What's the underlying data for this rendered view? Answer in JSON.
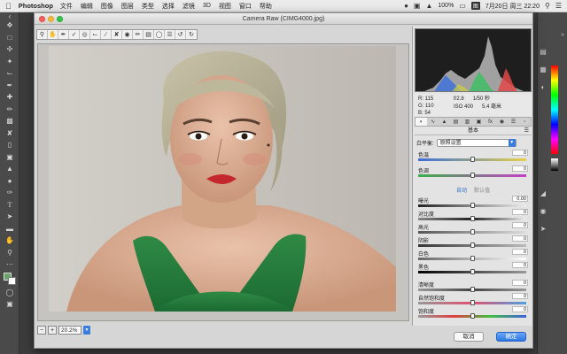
{
  "menubar": {
    "app": "Photoshop",
    "items": [
      "文件",
      "编辑",
      "图像",
      "图层",
      "类型",
      "选择",
      "滤镜",
      "3D",
      "视图",
      "窗口",
      "帮助"
    ],
    "battery": "100%",
    "datetime": "7月20日 周三  22:20",
    "badge": "图"
  },
  "dialog": {
    "title": "Camera Raw (CIMG4000.jpg)",
    "preview_label": "预览",
    "zoom": "20.2%",
    "cancel_label": "取消",
    "ok_label": "确定"
  },
  "readout": {
    "r": "R:  115",
    "g": "G:  110",
    "b": "B:    54",
    "aperture": "f/2.8",
    "shutter": "1/50 秒",
    "iso": "ISO 400",
    "focal": "5.4 毫米"
  },
  "panel": {
    "title": "基本",
    "wb_label": "白平衡:",
    "wb_value": "原照设置",
    "auto_label": "自动",
    "default_label": "默认值",
    "sliders": [
      {
        "label": "色温",
        "value": "0",
        "pos": 0.5
      },
      {
        "label": "色调",
        "value": "0",
        "pos": 0.5
      },
      {
        "label": "曝光",
        "value": "0.00",
        "pos": 0.5
      },
      {
        "label": "对比度",
        "value": "0",
        "pos": 0.5
      },
      {
        "label": "高光",
        "value": "0",
        "pos": 0.5
      },
      {
        "label": "阴影",
        "value": "0",
        "pos": 0.5
      },
      {
        "label": "白色",
        "value": "0",
        "pos": 0.5
      },
      {
        "label": "黑色",
        "value": "0",
        "pos": 0.5
      },
      {
        "label": "清晰度",
        "value": "0",
        "pos": 0.5
      },
      {
        "label": "自然饱和度",
        "value": "0",
        "pos": 0.5
      },
      {
        "label": "饱和度",
        "value": "0",
        "pos": 0.5
      }
    ]
  },
  "icons": {
    "dialog_tools": [
      "zoom-icon",
      "hand-icon",
      "white-balance-icon",
      "color-sampler-icon",
      "target-adjust-icon",
      "crop-icon",
      "straighten-icon",
      "spot-removal-icon",
      "red-eye-icon",
      "adjustment-brush-icon",
      "graduated-filter-icon",
      "radial-filter-icon",
      "preferences-icon",
      "rotate-ccw-icon",
      "rotate-cw-icon"
    ]
  }
}
